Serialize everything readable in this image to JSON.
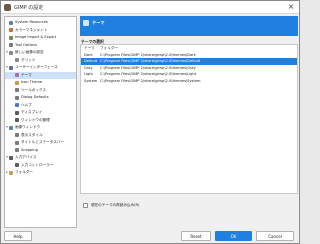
{
  "window": {
    "title": "GIMP の設定",
    "close_glyph": "×",
    "accent_color": "#1f80e0"
  },
  "sidebar": {
    "items": [
      {
        "label": "System Resources",
        "level": 0,
        "expander": "",
        "icon": "memory-icon",
        "color": "#5a7fb0"
      },
      {
        "label": "カラーマネジメント",
        "level": 0,
        "expander": "",
        "icon": "color-management-icon",
        "color": "#d06a3a"
      },
      {
        "label": "Image Import & Export",
        "level": 0,
        "expander": "",
        "icon": "image-import-export-icon",
        "color": "#6b8e4e"
      },
      {
        "label": "Tool Options",
        "level": 0,
        "expander": "",
        "icon": "tool-options-icon",
        "color": "#7a7a7a"
      },
      {
        "label": "新しい画像の設定",
        "level": 0,
        "expander": "▾",
        "icon": "new-image-icon",
        "color": "#8a8a8a"
      },
      {
        "label": "グリッド",
        "level": 1,
        "expander": "",
        "icon": "grid-icon",
        "color": "#8a8a8a"
      },
      {
        "label": "ユーザーインターフェース",
        "level": 0,
        "expander": "▾",
        "icon": "interface-icon",
        "color": "#5a6e9a"
      },
      {
        "label": "テーマ",
        "level": 1,
        "expander": "",
        "icon": "theme-icon",
        "color": "#b06ab0",
        "selected": true
      },
      {
        "label": "Icon Theme",
        "level": 1,
        "expander": "",
        "icon": "icon-theme-icon",
        "color": "#c89a3a"
      },
      {
        "label": "ツールボックス",
        "level": 1,
        "expander": "",
        "icon": "toolbox-icon",
        "color": "#7a7a7a"
      },
      {
        "label": "Dialog Defaults",
        "level": 1,
        "expander": "",
        "icon": "dialog-defaults-icon",
        "color": "#7a7a7a"
      },
      {
        "label": "ヘルプ",
        "level": 1,
        "expander": "",
        "icon": "help-icon",
        "color": "#4a7ac0"
      },
      {
        "label": "ディスプレイ",
        "level": 1,
        "expander": "",
        "icon": "display-icon",
        "color": "#5a5a5a"
      },
      {
        "label": "ウィンドウの管理",
        "level": 1,
        "expander": "",
        "icon": "window-management-icon",
        "color": "#5a5a5a"
      },
      {
        "label": "画像ウィンドウ",
        "level": 0,
        "expander": "▾",
        "icon": "image-window-icon",
        "color": "#5a7fb0"
      },
      {
        "label": "表示スタイル",
        "level": 1,
        "expander": "",
        "icon": "appearance-icon",
        "color": "#7a7a7a"
      },
      {
        "label": "タイトルとステータスバー",
        "level": 1,
        "expander": "",
        "icon": "title-status-icon",
        "color": "#7a7a7a"
      },
      {
        "label": "Snapping",
        "level": 1,
        "expander": "",
        "icon": "snapping-icon",
        "color": "#7a7a7a"
      },
      {
        "label": "入力デバイス",
        "level": 0,
        "expander": "▾",
        "icon": "input-devices-icon",
        "color": "#5a5a5a"
      },
      {
        "label": "入力コントローラー",
        "level": 1,
        "expander": "",
        "icon": "input-controllers-icon",
        "color": "#5a5a5a"
      },
      {
        "label": "フォルダー",
        "level": 0,
        "expander": "▸",
        "icon": "folders-icon",
        "color": "#c8a050"
      }
    ]
  },
  "page": {
    "title": "テーマ",
    "section_title": "テーマの選択",
    "table": {
      "columns": [
        "テーマ",
        "フォルダー"
      ],
      "rows": [
        {
          "name": "Dark",
          "folder": "C:\\Program Files\\GIMP 2\\share\\gimp\\2.0\\themes\\Dark"
        },
        {
          "name": "Default",
          "folder": "C:\\Program Files\\GIMP 2\\share\\gimp\\2.0\\themes\\Default",
          "selected": true
        },
        {
          "name": "Gray",
          "folder": "C:\\Program Files\\GIMP 2\\share\\gimp\\2.0\\themes\\Gray"
        },
        {
          "name": "Light",
          "folder": "C:\\Program Files\\GIMP 2\\share\\gimp\\2.0\\themes\\Light"
        },
        {
          "name": "System",
          "folder": "C:\\Program Files\\GIMP 2\\share\\gimp\\2.0\\themes\\System"
        }
      ]
    },
    "reload_checkbox": {
      "label": "現在のテーマの再読み込み(R)",
      "checked": false
    }
  },
  "footer": {
    "help_label": "Help",
    "reset_label": "Reset",
    "ok_label": "OK",
    "cancel_label": "Cancel"
  }
}
